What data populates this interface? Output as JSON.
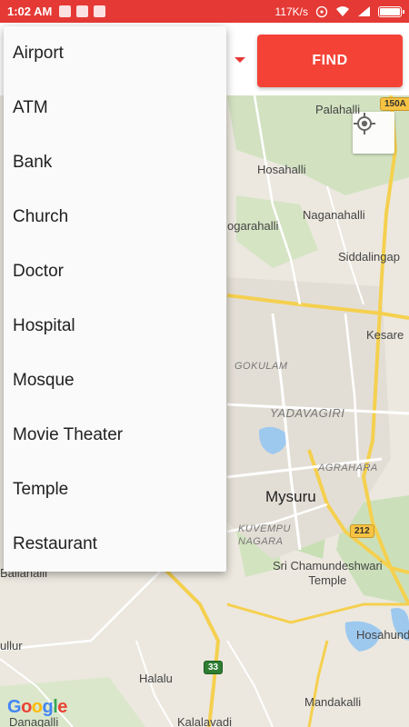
{
  "status_bar": {
    "time": "1:02 AM",
    "network_speed": "117K/s",
    "battery_level": 0.9
  },
  "find_button": {
    "label": "FIND"
  },
  "category_dropdown": {
    "options": [
      "Airport",
      "ATM",
      "Bank",
      "Church",
      "Doctor",
      "Hospital",
      "Mosque",
      "Movie Theater",
      "Temple",
      "Restaurant"
    ]
  },
  "map": {
    "labels": {
      "palahalli": "Palahalli",
      "hosahalli": "Hosahalli",
      "naganahalli": "Naganahalli",
      "belagola": "ogarahalli",
      "siddalingapura": "Siddalingap",
      "kesare": "Kesare",
      "gokulam": "GOKULAM",
      "yadavagiri": "YADAVAGIRI",
      "agrahara": "AGRAHARA",
      "mysuru": "Mysuru",
      "kuvempu": "KUVEMPU\nNAGARA",
      "sri_chamundeshwari": "Sri Chamundeshwari\nTemple",
      "ballahalli": "Ballahalli",
      "hosahundi": "Hosahund",
      "ullur": "ullur",
      "halalu": "Halalu",
      "mandakalli": "Mandakalli",
      "danagalli": "Danagalli",
      "kalalavadi": "Kalalavadi"
    },
    "shields": {
      "road_150a": "150A",
      "road_212": "212",
      "road_33": "33"
    },
    "attribution": "Google"
  }
}
